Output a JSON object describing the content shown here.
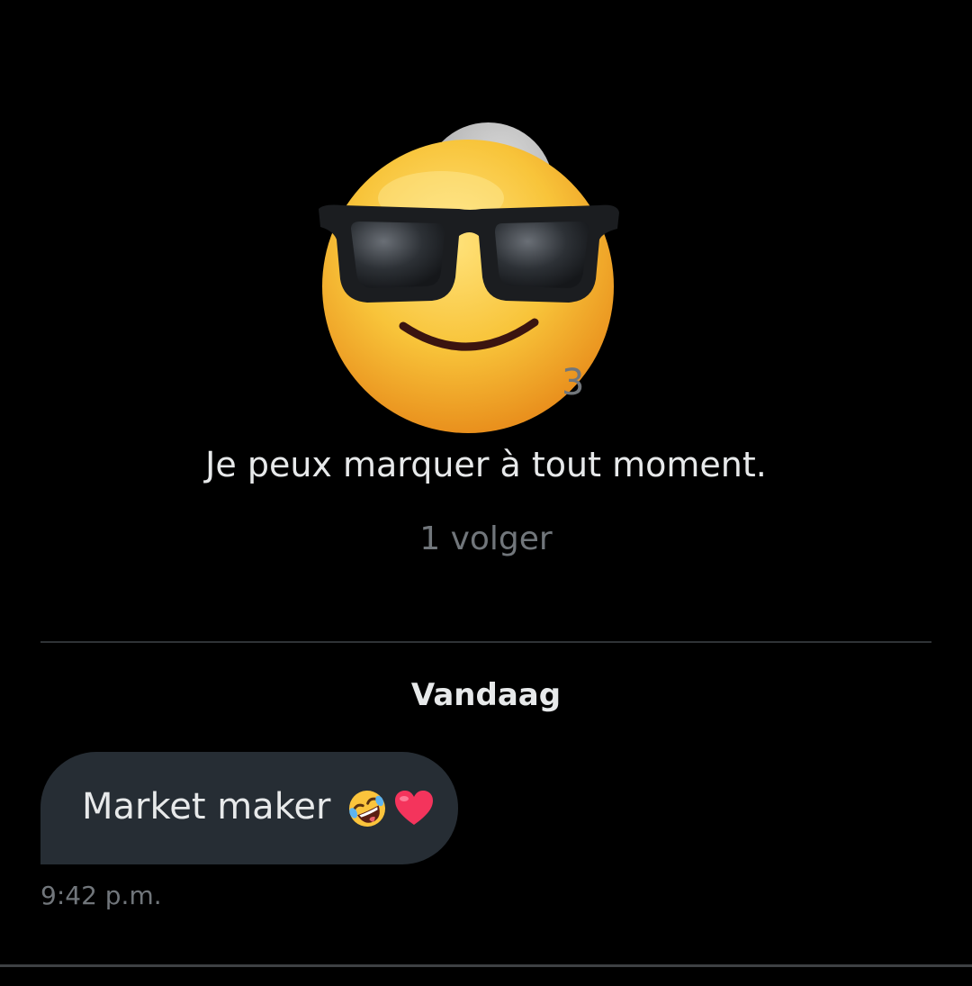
{
  "profile": {
    "avatar_icon": "smiling-face-with-sunglasses-icon",
    "handle_peek": "3",
    "bio": "Je peux marquer à tout moment.",
    "followers": "1 volger"
  },
  "conversation": {
    "date_label": "Vandaag",
    "messages": [
      {
        "text": "Market maker",
        "emojis": [
          "rolling-on-the-floor-laughing-icon",
          "heart-icon"
        ],
        "time": "9:42 p.m."
      }
    ]
  },
  "colors": {
    "background": "#000000",
    "primary_text": "#e7e9ea",
    "secondary_text": "#71767b",
    "bubble": "#262d34",
    "divider": "#2f3336"
  }
}
